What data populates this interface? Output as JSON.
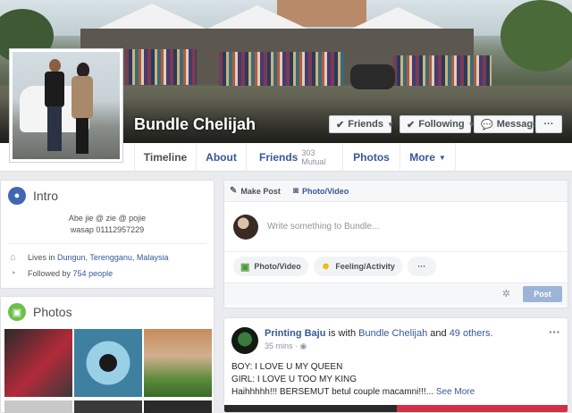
{
  "profile": {
    "name": "Bundle Chelijah"
  },
  "cover_buttons": {
    "friends": "Friends",
    "following": "Following",
    "message": "Message",
    "more": "···"
  },
  "nav": {
    "tabs": [
      {
        "label": "Timeline"
      },
      {
        "label": "About"
      },
      {
        "label": "Friends",
        "sub": "303 Mutual"
      },
      {
        "label": "Photos"
      },
      {
        "label": "More"
      }
    ]
  },
  "intro": {
    "title": "Intro",
    "bio_line1": "Abe jie @ zie @ pojie",
    "bio_line2": "wasap 01112957229",
    "lives_prefix": "Lives in",
    "lives_place": "Dungun, Terengganu, Malaysia",
    "followed_prefix": "Followed by",
    "followed_count": "754 people"
  },
  "photos": {
    "title": "Photos"
  },
  "composer": {
    "tab_make_post": "Make Post",
    "tab_photo_video": "Photo/Video",
    "placeholder": "Write something to Bundle...",
    "photo_video": "Photo/Video",
    "feeling": "Feeling/Activity",
    "more": "···",
    "post_button": "Post"
  },
  "post": {
    "author": "Printing Baju",
    "with_text": "is with",
    "tagged": "Bundle Chelijah",
    "and_text": "and",
    "others": "49 others.",
    "time": "35 mins",
    "line1": "BOY: I LOVE U MY QUEEN",
    "line2": "GIRL: I LOVE U TOO MY KING",
    "line3": "Haihhhhh!!! BERSEMUT betul couple macamni!!!...",
    "see_more": "See More",
    "menu": "···"
  },
  "colors": {
    "link": "#365899",
    "post_button": "#9cb4d8",
    "background": "#e9ebee"
  }
}
